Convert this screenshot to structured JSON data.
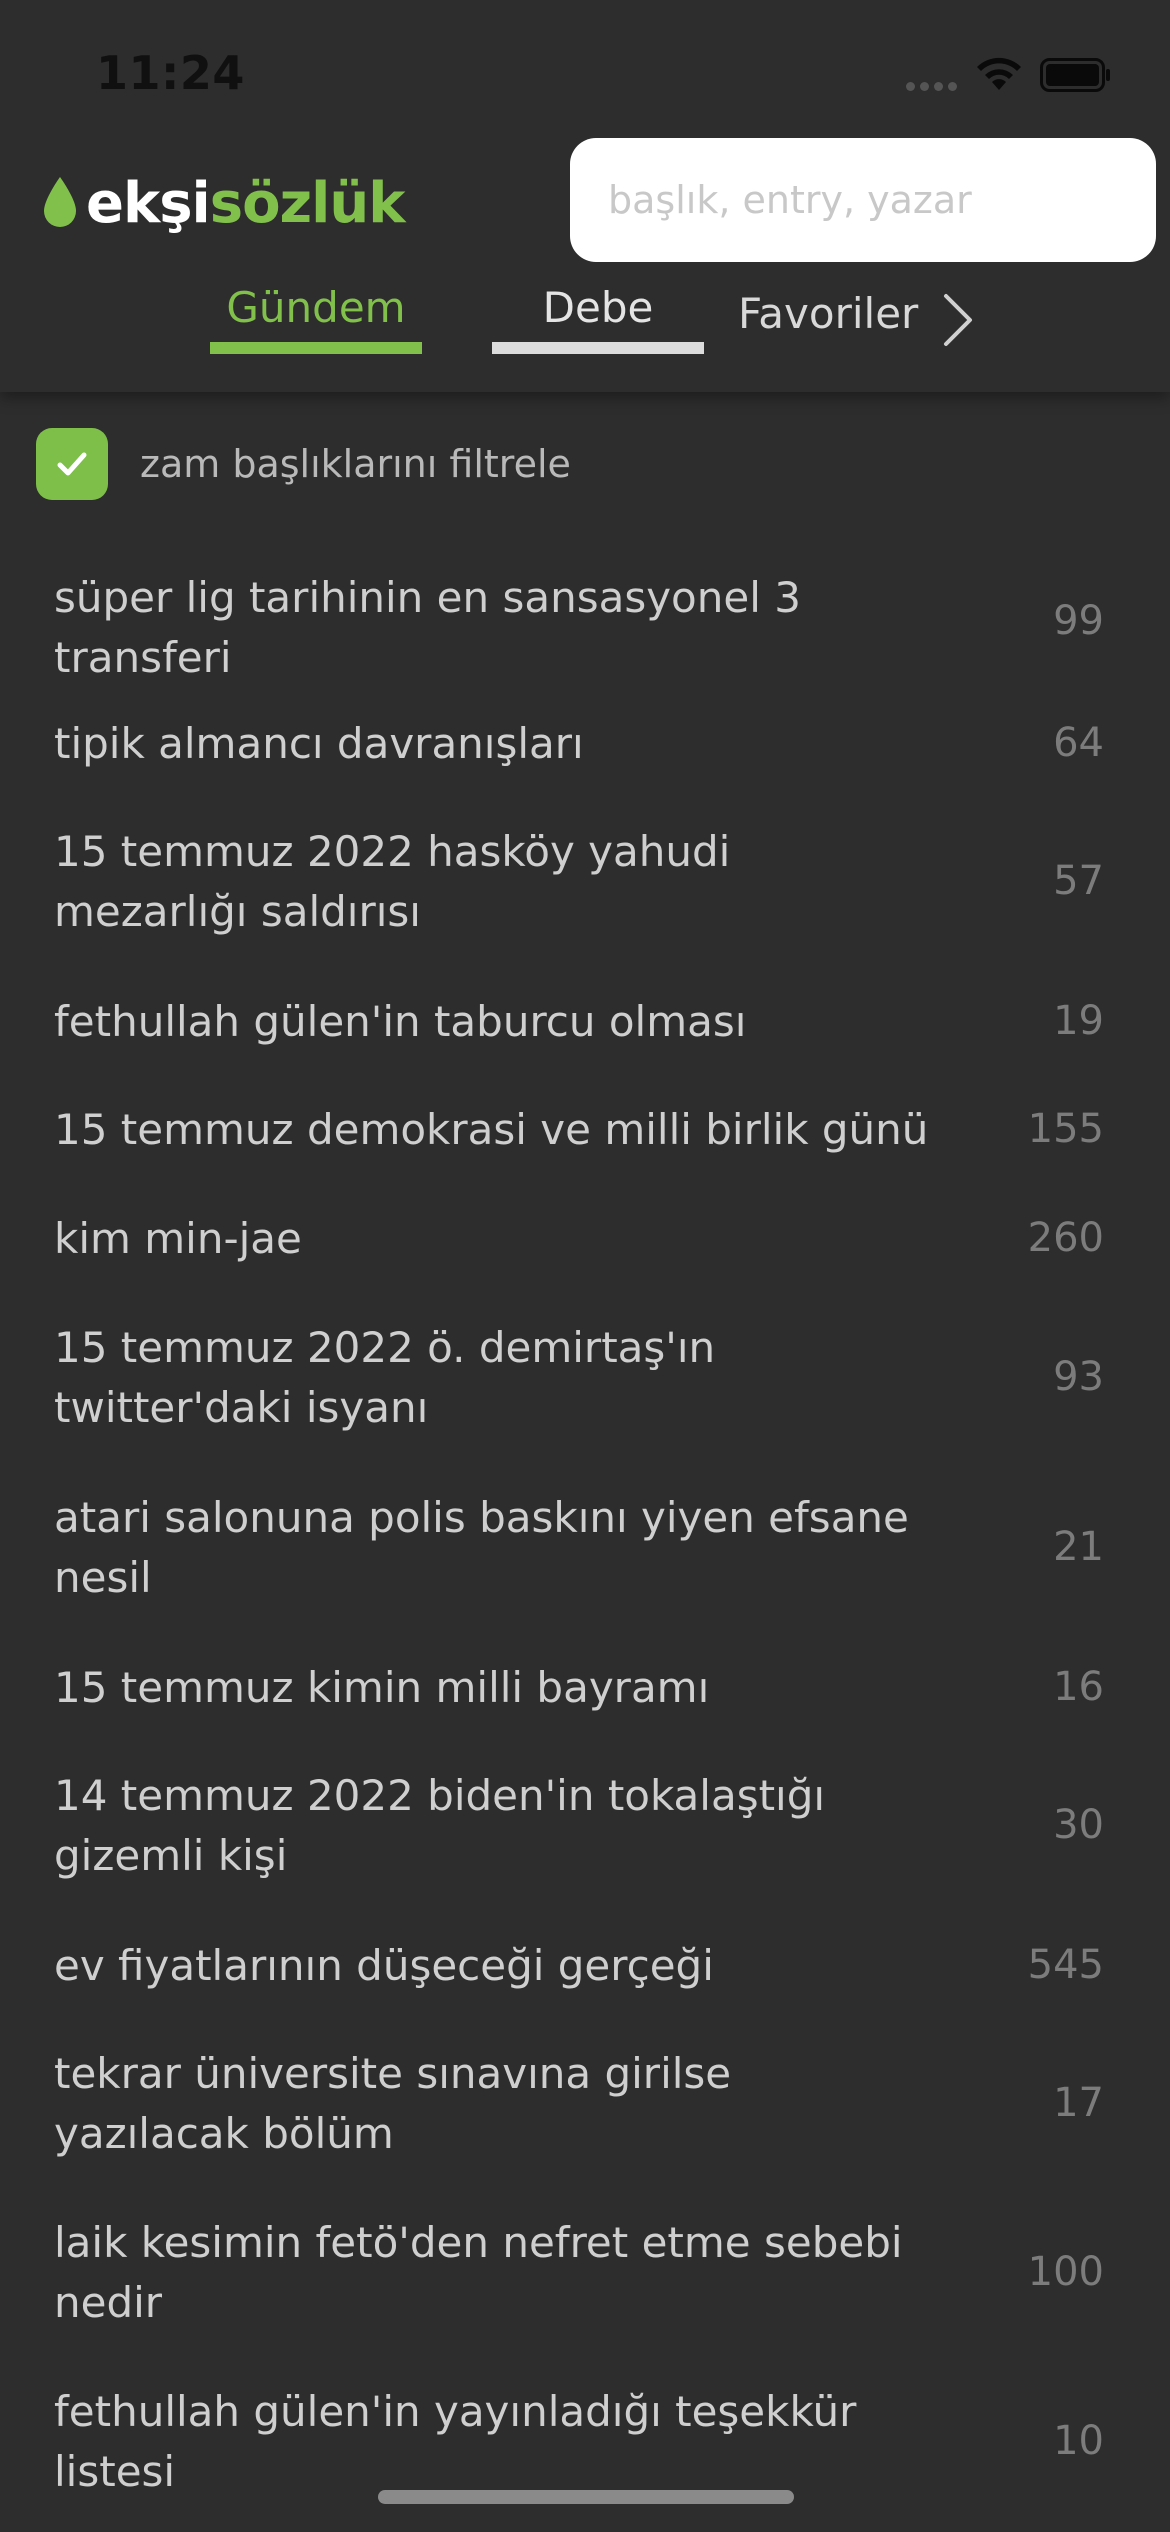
{
  "status_bar": {
    "time": "11:24"
  },
  "logo": {
    "part1": "ekşi",
    "part2": "sözlük",
    "colors": {
      "accent": "#81c14b",
      "primary": "#ffffff"
    }
  },
  "search": {
    "placeholder": "başlık, entry, yazar",
    "value": ""
  },
  "tabs": [
    {
      "label": "Gündem",
      "active": true
    },
    {
      "label": "Debe",
      "active": false
    },
    {
      "label": "Favoriler",
      "active": false
    }
  ],
  "filter": {
    "label": "zam başlıklarını filtrele",
    "checked": true
  },
  "topics": [
    {
      "title": "süper lig tarihinin en sansasyonel 3 transferi",
      "count": "99"
    },
    {
      "title": "tipik almancı davranışları",
      "count": "64"
    },
    {
      "title": "15 temmuz 2022 hasköy yahudi mezarlığı saldırısı",
      "count": "57"
    },
    {
      "title": "fethullah gülen'in taburcu olması",
      "count": "19"
    },
    {
      "title": "15 temmuz demokrasi ve milli birlik günü",
      "count": "155"
    },
    {
      "title": "kim min-jae",
      "count": "260"
    },
    {
      "title": "15 temmuz 2022 ö. demirtaş'ın twitter'daki isyanı",
      "count": "93"
    },
    {
      "title": "atari salonuna polis baskını yiyen efsane nesil",
      "count": "21"
    },
    {
      "title": "15 temmuz kimin milli bayramı",
      "count": "16"
    },
    {
      "title": "14 temmuz 2022 biden'in tokalaştığı gizemli kişi",
      "count": "30"
    },
    {
      "title": "ev fiyatlarının düşeceği gerçeği",
      "count": "545"
    },
    {
      "title": "tekrar üniversite sınavına girilse yazılacak bölüm",
      "count": "17"
    },
    {
      "title": "laik kesimin fetö'den nefret etme sebebi nedir",
      "count": "100"
    },
    {
      "title": "fethullah gülen'in yayınladığı teşekkür listesi",
      "count": "10"
    }
  ]
}
